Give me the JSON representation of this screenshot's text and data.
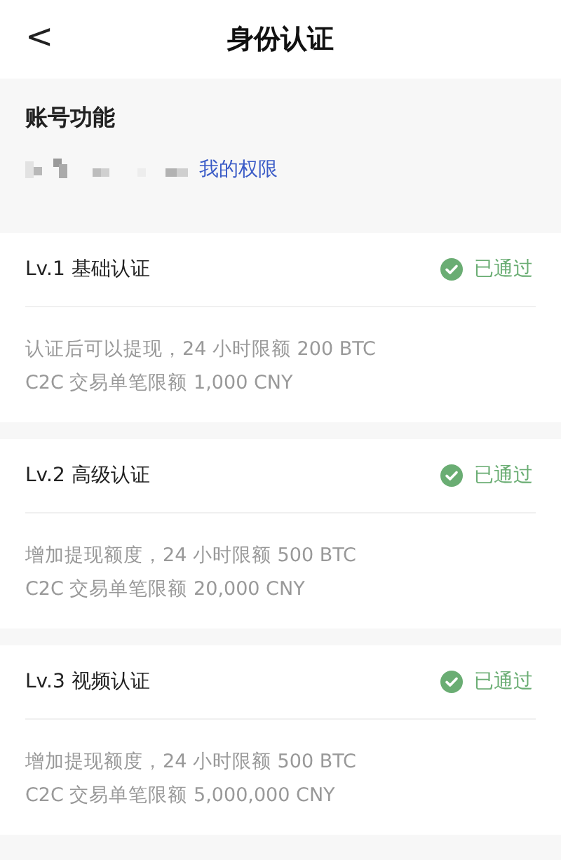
{
  "header": {
    "back": "<",
    "title": "身份认证"
  },
  "account": {
    "title": "账号功能",
    "link": "我的权限"
  },
  "levels": [
    {
      "name": "Lv.1 基础认证",
      "status": "已通过",
      "verified": true,
      "lines": [
        "认证后可以提现，24 小时限额 200 BTC",
        "C2C 交易单笔限额 1,000 CNY"
      ]
    },
    {
      "name": "Lv.2 高级认证",
      "status": "已通过",
      "verified": true,
      "lines": [
        "增加提现额度，24 小时限额 500 BTC",
        "C2C 交易单笔限额 20,000 CNY"
      ]
    },
    {
      "name": "Lv.3 视频认证",
      "status": "已通过",
      "verified": true,
      "lines": [
        "增加提现额度，24 小时限额 500 BTC",
        "C2C 交易单笔限额 5,000,000 CNY"
      ]
    }
  ]
}
